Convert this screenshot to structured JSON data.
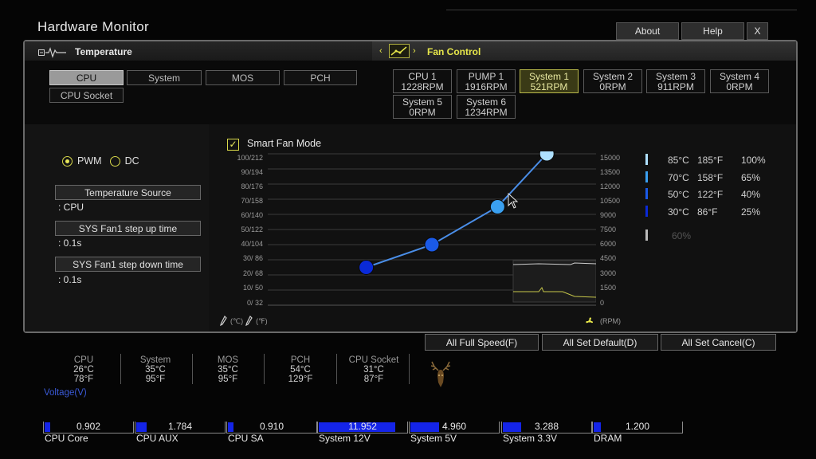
{
  "window": {
    "title": "Hardware Monitor",
    "buttons": {
      "about": "About",
      "help": "Help",
      "close": "X"
    }
  },
  "temperature_panel": {
    "header": "Temperature",
    "tabs": [
      "CPU",
      "System",
      "MOS",
      "PCH",
      "CPU Socket"
    ],
    "active_tab": "CPU"
  },
  "fan_control": {
    "header": "Fan Control",
    "fans": [
      {
        "name": "CPU 1",
        "rpm": "1228RPM"
      },
      {
        "name": "PUMP 1",
        "rpm": "1916RPM"
      },
      {
        "name": "System 1",
        "rpm": "521RPM"
      },
      {
        "name": "System 2",
        "rpm": "0RPM"
      },
      {
        "name": "System 3",
        "rpm": "911RPM"
      },
      {
        "name": "System 4",
        "rpm": "0RPM"
      },
      {
        "name": "System 5",
        "rpm": "0RPM"
      },
      {
        "name": "System 6",
        "rpm": "1234RPM"
      }
    ],
    "active_fan": "System 1"
  },
  "settings": {
    "pwm_label": "PWM",
    "dc_label": "DC",
    "mode": "PWM",
    "temperature_source": {
      "label": "Temperature Source",
      "value": ": CPU"
    },
    "step_up": {
      "label": "SYS Fan1 step up time",
      "value": ": 0.1s"
    },
    "step_down": {
      "label": "SYS Fan1 step down time",
      "value": ": 0.1s"
    }
  },
  "smart_fan": {
    "label": "Smart Fan Mode",
    "enabled": true,
    "left_axis_ticks": [
      "100/212",
      "90/194",
      "80/176",
      "70/158",
      "60/140",
      "50/122",
      "40/104",
      "30/ 86",
      "20/ 68",
      "10/ 50",
      "0/ 32"
    ],
    "right_axis_ticks": [
      "15000",
      "13500",
      "12000",
      "10500",
      "9000",
      "7500",
      "6000",
      "4500",
      "3000",
      "1500",
      "0"
    ],
    "unit_c": "(℃)",
    "unit_f": "(℉)",
    "unit_rpm": "(RPM)"
  },
  "chart_data": {
    "type": "line",
    "x_unit": "°C",
    "y_unit": "% fan speed",
    "points": [
      {
        "temp_c": 30,
        "speed_pct": 25,
        "color": "#0a2ad8"
      },
      {
        "temp_c": 50,
        "speed_pct": 40,
        "color": "#1a5ae8"
      },
      {
        "temp_c": 70,
        "speed_pct": 65,
        "color": "#3aa0f0"
      },
      {
        "temp_c": 85,
        "speed_pct": 100,
        "color": "#aee0ff"
      }
    ],
    "legend": [
      {
        "c": "85°C",
        "f": "185°F",
        "pct": "100%",
        "color": "#aee0ff"
      },
      {
        "c": "70°C",
        "f": "158°F",
        "pct": "65%",
        "color": "#3aa0f0"
      },
      {
        "c": "50°C",
        "f": "122°F",
        "pct": "40%",
        "color": "#1a5ae8"
      },
      {
        "c": "30°C",
        "f": "86°F",
        "pct": "25%",
        "color": "#0a2ad8"
      }
    ],
    "extra_legend": {
      "pct": "60%",
      "color": "#bbbbbb"
    }
  },
  "actions": {
    "full_speed": "All Full Speed(F)",
    "set_default": "All Set Default(D)",
    "set_cancel": "All Set Cancel(C)"
  },
  "temps": [
    {
      "name": "CPU",
      "c": "26°C",
      "f": "78°F"
    },
    {
      "name": "System",
      "c": "35°C",
      "f": "95°F"
    },
    {
      "name": "MOS",
      "c": "35°C",
      "f": "95°F"
    },
    {
      "name": "PCH",
      "c": "54°C",
      "f": "129°F"
    },
    {
      "name": "CPU Socket",
      "c": "31°C",
      "f": "87°F"
    }
  ],
  "voltage": {
    "header": "Voltage(V)",
    "accent": "#1424e8",
    "items": [
      {
        "name": "CPU Core",
        "value": "0.902",
        "level": 0.06
      },
      {
        "name": "CPU AUX",
        "value": "1.784",
        "level": 0.12
      },
      {
        "name": "CPU SA",
        "value": "0.910",
        "level": 0.06
      },
      {
        "name": "System 12V",
        "value": "11.952",
        "level": 0.87
      },
      {
        "name": "System 5V",
        "value": "4.960",
        "level": 0.33
      },
      {
        "name": "System 3.3V",
        "value": "3.288",
        "level": 0.21
      },
      {
        "name": "DRAM",
        "value": "1.200",
        "level": 0.08
      }
    ]
  }
}
